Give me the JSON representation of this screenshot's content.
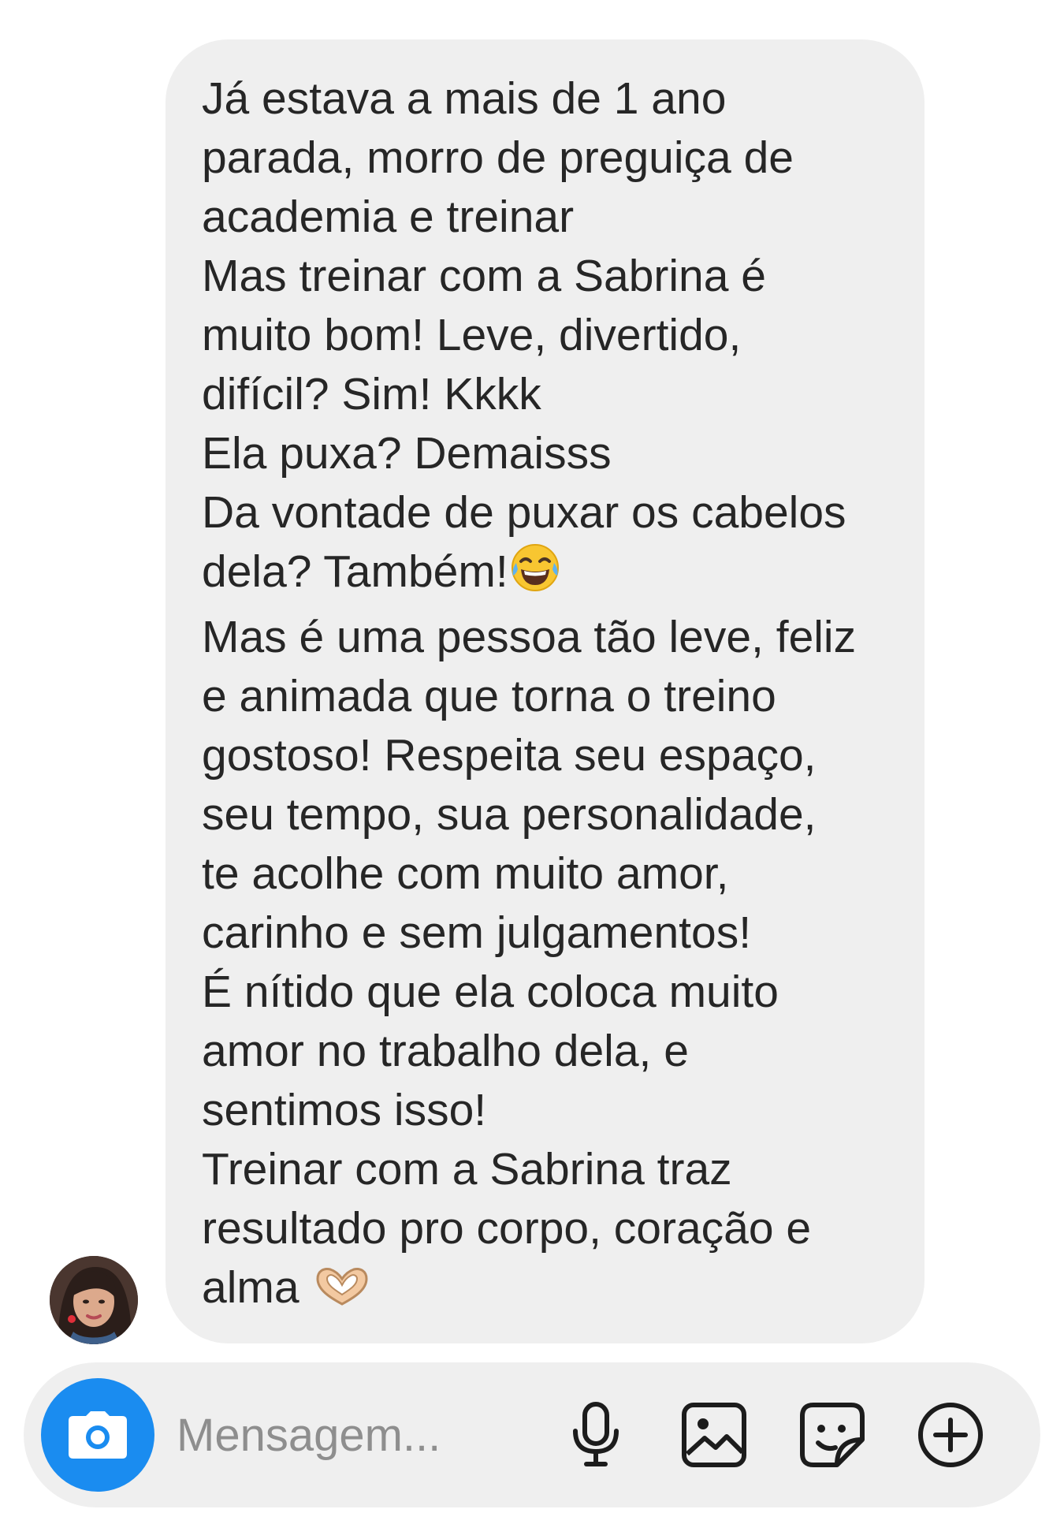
{
  "message": {
    "lines": [
      "Já estava a mais de 1 ano",
      "parada, morro de preguiça de",
      "academia e treinar",
      "Mas treinar com a Sabrina é",
      "muito bom! Leve, divertido,",
      "difícil? Sim! Kkkk",
      "Ela puxa? Demaisss",
      "Da vontade de puxar os cabelos",
      "dela? Também!",
      "Mas é uma pessoa tão leve, feliz",
      "e animada que torna o treino",
      "gostoso! Respeita seu espaço,",
      "seu tempo, sua personalidade,",
      "te acolhe com muito amor,",
      "carinho e sem julgamentos!",
      "É nítido que ela coloca muito",
      "amor no trabalho dela, e",
      "sentimos isso!",
      "Treinar com a Sabrina traz",
      "resultado pro corpo, coração e",
      "alma"
    ],
    "emojis": {
      "line_9": "laughing-tears-emoji",
      "line_21": "heart-hands-emoji"
    },
    "bubble_color": "#efefef",
    "text_color": "#262626"
  },
  "sender": {
    "avatar_icon": "profile-photo"
  },
  "composer": {
    "placeholder": "Mensagem...",
    "camera_icon": "camera-icon",
    "accent_color": "#1a8cf0",
    "actions": [
      "microphone-icon",
      "gallery-icon",
      "sticker-icon",
      "plus-circle-icon"
    ]
  }
}
